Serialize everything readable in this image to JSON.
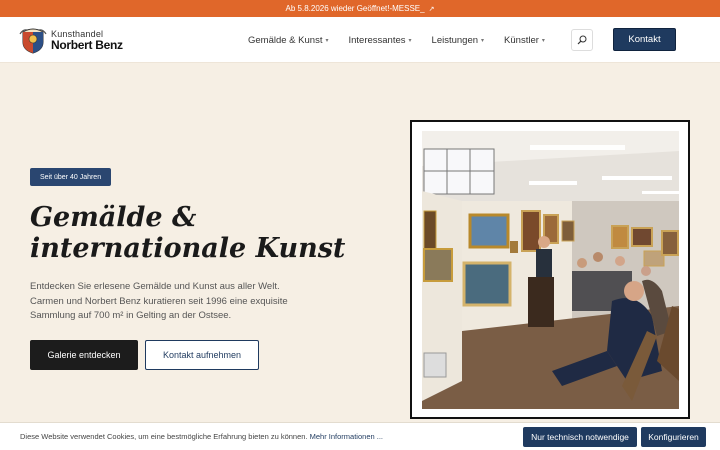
{
  "topbar": {
    "text": "Ab 5.8.2026 wieder Geöffnet!-MESSE_",
    "arrow_icon": "external-link-icon",
    "color": "#e0672a"
  },
  "logo": {
    "line1": "Kunsthandel",
    "line2": "Norbert Benz"
  },
  "nav": [
    {
      "label": "Gemälde & Kunst"
    },
    {
      "label": "Interessantes"
    },
    {
      "label": "Leistungen"
    },
    {
      "label": "Künstler"
    }
  ],
  "header": {
    "search_icon": "search-icon",
    "contact_label": "Kontakt"
  },
  "hero": {
    "badge": "Seit über 40 Jahren",
    "title_line1": "Gemälde &",
    "title_line2": "internationale Kunst",
    "description": "Entdecken Sie erlesene Gemälde und Kunst aus aller Welt. Carmen und Norbert Benz kuratieren seit 1996 eine exquisite Sammlung auf 700 m² in Gelting an der Ostsee.",
    "primary_button": "Galerie entdecken",
    "secondary_button": "Kontakt aufnehmen"
  },
  "cookie": {
    "text": "Diese Website verwendet Cookies, um eine bestmögliche Erfahrung bieten zu können.",
    "link": "Mehr Informationen ...",
    "button_necessary": "Nur technisch notwendige",
    "button_configure": "Konfigurieren"
  },
  "colors": {
    "brand_dark_blue": "#1f3a5f",
    "background": "#f6efe4",
    "accent_orange": "#e0672a"
  }
}
